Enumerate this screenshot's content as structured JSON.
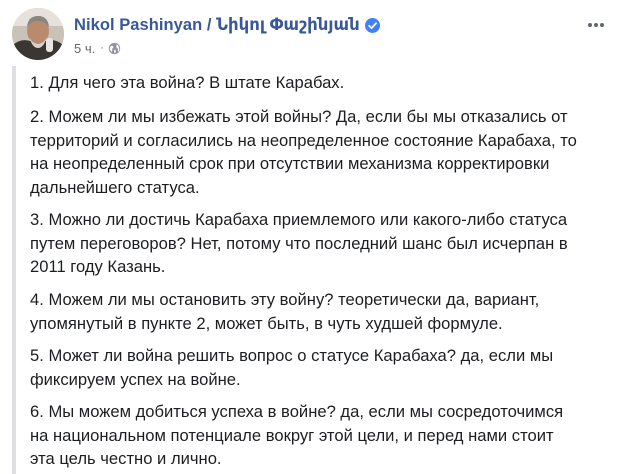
{
  "post": {
    "author": "Nikol Pashinyan / Նիկոլ Փաշինյան",
    "timestamp": "5 ч.",
    "separator": "·",
    "icons": {
      "verified": "verified-badge-icon",
      "audience": "globe-icon",
      "more": "more-options-icon",
      "avatar": "profile-photo"
    },
    "colors": {
      "author": "#385898",
      "verified": "#4080ff",
      "text": "#1c1e21",
      "meta": "#606770",
      "quote_bar": "#dddfe2"
    },
    "paragraphs": [
      {
        "lines": [
          "1. Для чего эта война? В штате Карабах."
        ]
      },
      {
        "lines": [
          "2. Можем ли мы избежать этой войны? Да, если бы мы отказались от",
          "территорий и согласились на неопределенное состояние Карабаха, то",
          "на неопределенный срок при отсутствии механизма корректировки",
          "дальнейшего статуса."
        ]
      },
      {
        "lines": [
          "3. Можно ли достичь Карабаха приемлемого или какого-либо статуса",
          "путем переговоров? Нет, потому что последний шанс был исчерпан в",
          "2011 году Казань."
        ]
      },
      {
        "lines": [
          "4. Можем ли мы остановить эту войну? теоретически да, вариант,",
          "упомянутый в пункте 2, может быть, в чуть худшей формуле."
        ]
      },
      {
        "lines": [
          "5. Может ли война решить вопрос о статусе Карабаха? да, если мы",
          "фиксируем успех на войне."
        ]
      },
      {
        "lines": [
          "6. Мы можем добиться успеха в войне? да, если мы сосредоточимся",
          "на национальном потенциале вокруг этой цели, и перед нами стоит",
          "эта цель честно и лично."
        ]
      }
    ]
  }
}
